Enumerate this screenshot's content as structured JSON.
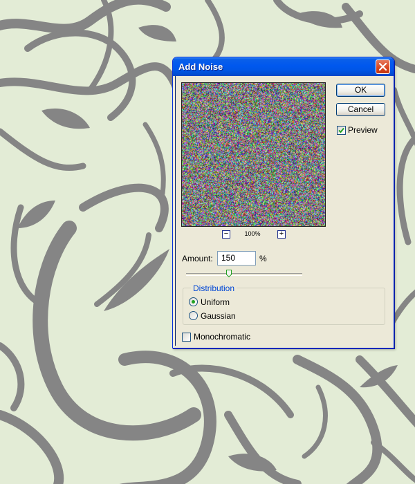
{
  "dialog": {
    "title": "Add Noise",
    "ok_label": "OK",
    "cancel_label": "Cancel",
    "preview_label": "Preview",
    "preview_checked": true,
    "zoom_level": "100%",
    "zoom_out_label": "−",
    "zoom_in_label": "+",
    "amount_label": "Amount:",
    "amount_value": "150",
    "amount_unit": "%",
    "distribution_legend": "Distribution",
    "distribution_options": [
      {
        "label": "Uniform",
        "selected": true
      },
      {
        "label": "Gaussian",
        "selected": false
      }
    ],
    "monochromatic_label": "Monochromatic",
    "monochromatic_checked": false
  },
  "colors": {
    "background": "#e3ecd6",
    "vine": "#858585",
    "titlebar": "#0058ee",
    "close_button": "#d9441e",
    "accent_legend": "#0046d5"
  },
  "icons": {
    "close": "close-icon",
    "zoom_out": "zoom-out-icon",
    "zoom_in": "zoom-in-icon",
    "checkmark": "checkmark-icon",
    "slider": "slider-thumb-icon"
  }
}
